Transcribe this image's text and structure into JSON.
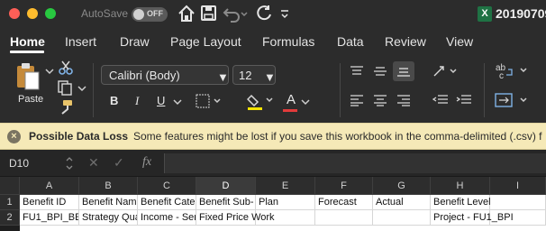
{
  "titlebar": {
    "autosave_label": "AutoSave",
    "autosave_state": "OFF",
    "filename": "20190709"
  },
  "ribbon_tabs": [
    "Home",
    "Insert",
    "Draw",
    "Page Layout",
    "Formulas",
    "Data",
    "Review",
    "View"
  ],
  "ribbon": {
    "paste_label": "Paste",
    "font_name": "Calibri (Body)",
    "font_size": "12",
    "bold": "B",
    "italic": "I",
    "underline": "U",
    "font_color_glyph": "A",
    "highlight_color": "#f5e400",
    "font_color": "#e23b3b"
  },
  "message_bar": {
    "title": "Possible Data Loss",
    "text": "Some features might be lost if you save this workbook in the comma-delimited (.csv) f"
  },
  "formula_bar": {
    "name_box": "D10",
    "fx": "fx",
    "content": ""
  },
  "grid": {
    "columns": [
      "A",
      "B",
      "C",
      "D",
      "E",
      "F",
      "G",
      "H",
      "I"
    ],
    "selected_column": "D",
    "rows": [
      {
        "num": "1",
        "cells": [
          "Benefit ID",
          "Benefit Nam",
          "Benefit Cate",
          "Benefit Sub-",
          "Plan",
          "Forecast",
          "Actual",
          "Benefit Level",
          ""
        ]
      },
      {
        "num": "2",
        "cells": [
          "FU1_BPI_BE",
          "Strategy Qua",
          "Income - Ser",
          "Fixed Price Work",
          "",
          "",
          "",
          "Project - FU1_BPI",
          ""
        ]
      }
    ]
  },
  "colors": {
    "accent_excel": "#1f7244",
    "message_bar_bg": "#f5e9b7"
  }
}
